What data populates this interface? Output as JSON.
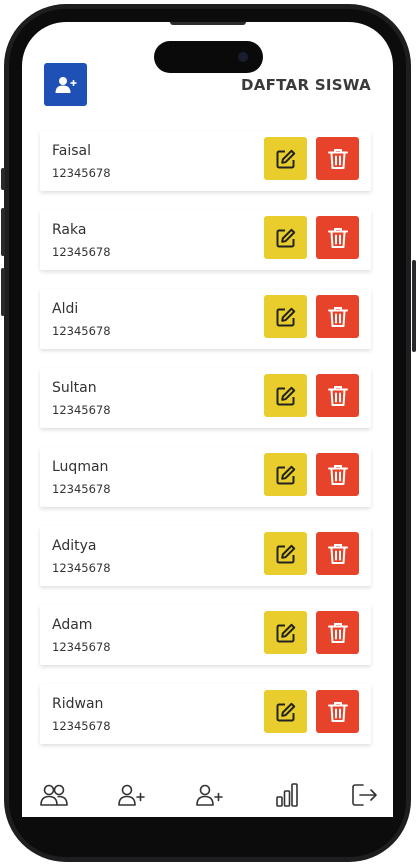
{
  "header": {
    "title": "DAFTAR SISWA",
    "add_button_icon": "user-plus-icon"
  },
  "students": [
    {
      "name": "Faisal",
      "nis": "12345678"
    },
    {
      "name": "Raka",
      "nis": "12345678"
    },
    {
      "name": "Aldi",
      "nis": "12345678"
    },
    {
      "name": "Sultan",
      "nis": "12345678"
    },
    {
      "name": "Luqman",
      "nis": "12345678"
    },
    {
      "name": "Aditya",
      "nis": "12345678"
    },
    {
      "name": "Adam",
      "nis": "12345678"
    },
    {
      "name": "Ridwan",
      "nis": "12345678"
    }
  ],
  "row_actions": {
    "edit_icon": "edit-icon",
    "delete_icon": "trash-icon"
  },
  "navbar": {
    "items": [
      "users-icon",
      "user-plus-icon",
      "user-plus-icon",
      "bar-chart-icon",
      "logout-icon"
    ]
  },
  "colors": {
    "primary": "#1f50b5",
    "edit": "#e8cd2c",
    "delete": "#e6432a",
    "title": "#3a3a3a"
  }
}
